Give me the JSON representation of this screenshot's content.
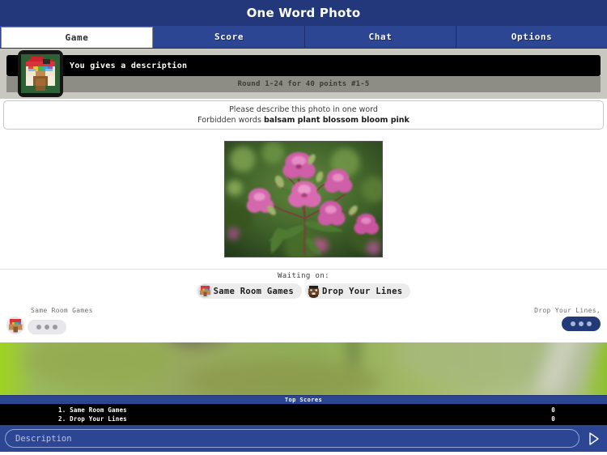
{
  "window": {
    "title": "One Word Photo"
  },
  "tabs": [
    {
      "label": "Game",
      "active": true
    },
    {
      "label": "Score",
      "active": false
    },
    {
      "label": "Chat",
      "active": false
    },
    {
      "label": "Options",
      "active": false
    }
  ],
  "status": {
    "message": "You gives a description",
    "round": "Round 1-24 for 40 points #1-5",
    "avatar_name": "player-avatar-self"
  },
  "prompt": {
    "instruction": "Please describe this photo in one word",
    "forbidden_label": "Forbidden words",
    "forbidden_words": "balsam plant blossom bloom pink"
  },
  "photo": {
    "alt": "Pink himalayan balsam flowers on green foliage"
  },
  "waiting": {
    "label": "Waiting on:",
    "players": [
      {
        "name": "Same Room Games"
      },
      {
        "name": "Drop Your Lines"
      }
    ]
  },
  "chat": {
    "left": {
      "name": "Same Room Games",
      "typing": true
    },
    "right": {
      "name": "Drop Your Lines,",
      "typing": true
    }
  },
  "scores": {
    "header": "Top Scores",
    "rows": [
      {
        "name": "1. Same Room Games",
        "points": "0"
      },
      {
        "name": "2. Drop Your Lines",
        "points": "0"
      }
    ]
  },
  "input": {
    "placeholder": "Description",
    "value": "",
    "send_icon": "send-arrow-icon"
  },
  "colors": {
    "title_bar": "#23387a",
    "tab_bar": "#2c4694",
    "active_tab_bg": "#ffffff",
    "status_strip": "#c9c8c0",
    "black_bar": "#000000",
    "gray_bar": "#8d8d85",
    "bubble_light": "#e8e8ec",
    "bubble_dark": "#223a77"
  }
}
